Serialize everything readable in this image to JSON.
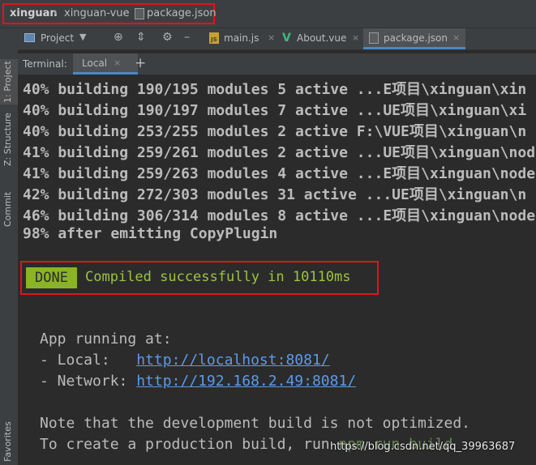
{
  "breadcrumb": {
    "root": "xinguan",
    "project": "xinguan-vue",
    "file": "package.json"
  },
  "sidebar": {
    "project_tab": "1: Project",
    "structure_tab": "Z: Structure",
    "commit_tab": "Commit",
    "favorites_tab": "Favorites"
  },
  "toolbar": {
    "project_label": "Project",
    "tabs": [
      {
        "label": "main.js",
        "icon": "js-file-icon"
      },
      {
        "label": "About.vue",
        "icon": "vue-file-icon"
      },
      {
        "label": "package.json",
        "icon": "json-file-icon"
      }
    ]
  },
  "terminal": {
    "label": "Terminal:",
    "tab_label": "Local",
    "lines": [
      "40% building 190/195 modules 5 active ...E项目\\xinguan\\xin",
      "40% building 190/197 modules 7 active ...UE项目\\xinguan\\xi",
      "40% building 253/255 modules 2 active F:\\VUE项目\\xinguan\\n",
      "41% building 259/261 modules 2 active ...UE项目\\xinguan\\nod",
      "41% building 259/263 modules 4 active ...E项目\\xinguan\\node",
      "42% building 272/303 modules 31 active ...UE项目\\xinguan\\n",
      "46% building 306/314 modules 8 active ...E项目\\xinguan\\node",
      "98% after emitting CopyPlugin"
    ],
    "done_badge": "DONE",
    "done_message": "Compiled successfully in 10110ms",
    "app_running": "App running at:",
    "local_label": "- Local:   ",
    "local_url": "http://localhost:8081/",
    "network_label": "- Network: ",
    "network_url": "http://192.168.2.49:8081/",
    "note_line": "Note that the development build is not optimized.",
    "prod_line": "To create a production build, run ",
    "prod_cmd": "npm run build"
  },
  "watermark": "https://blog.csdn.net/qq_39963687",
  "colors": {
    "highlight_box": "#e8101b",
    "done_badge": "#8ab425",
    "done_text": "#9dc43f",
    "link": "#5a9bea"
  }
}
